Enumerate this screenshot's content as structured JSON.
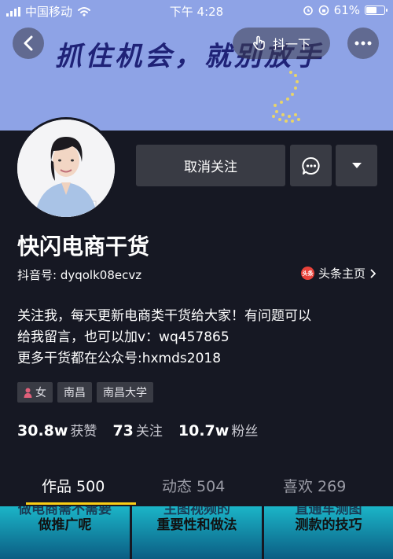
{
  "status_bar": {
    "carrier": "中国移动",
    "time": "下午 4:28",
    "battery": "61%",
    "battery_level": 0.61
  },
  "banner": {
    "text": "抓住机会，就别放手",
    "background": "#8ea3e6"
  },
  "top_actions": {
    "pill_label": "抖一下"
  },
  "profile": {
    "name": "快闪电商干货",
    "douyin_id": "抖音号: dyqolk08ecvz",
    "toutiao_label": "头条主页",
    "toutiao_badge": "头条"
  },
  "buttons": {
    "unfollow": "取消关注"
  },
  "bio": {
    "lines": [
      "关注我，每天更新电商类干货给大家！有问题可以",
      "给我留言，也可以加v：wq457865",
      "更多干货都在公众号:hxmds2018"
    ]
  },
  "tags": [
    {
      "label": "女",
      "icon": "female-icon"
    },
    {
      "label": "南昌"
    },
    {
      "label": "南昌大学"
    }
  ],
  "stats": [
    {
      "value": "30.8w",
      "label": "获赞"
    },
    {
      "value": "73",
      "label": "关注"
    },
    {
      "value": "10.7w",
      "label": "粉丝"
    }
  ],
  "tabs": [
    {
      "label": "作品 500",
      "active": true
    },
    {
      "label": "动态 504",
      "active": false
    },
    {
      "label": "喜欢 269",
      "active": false
    }
  ],
  "thumbnails": [
    {
      "line1": "做电商需不需要",
      "line2": "做推广呢"
    },
    {
      "line1": "主图视频的",
      "line2": "重要性和做法"
    },
    {
      "line1": "直通车测图",
      "line2": "测款的技巧"
    }
  ],
  "colors": {
    "background": "#161823",
    "button_bg": "#393b44",
    "accent": "#face15"
  }
}
